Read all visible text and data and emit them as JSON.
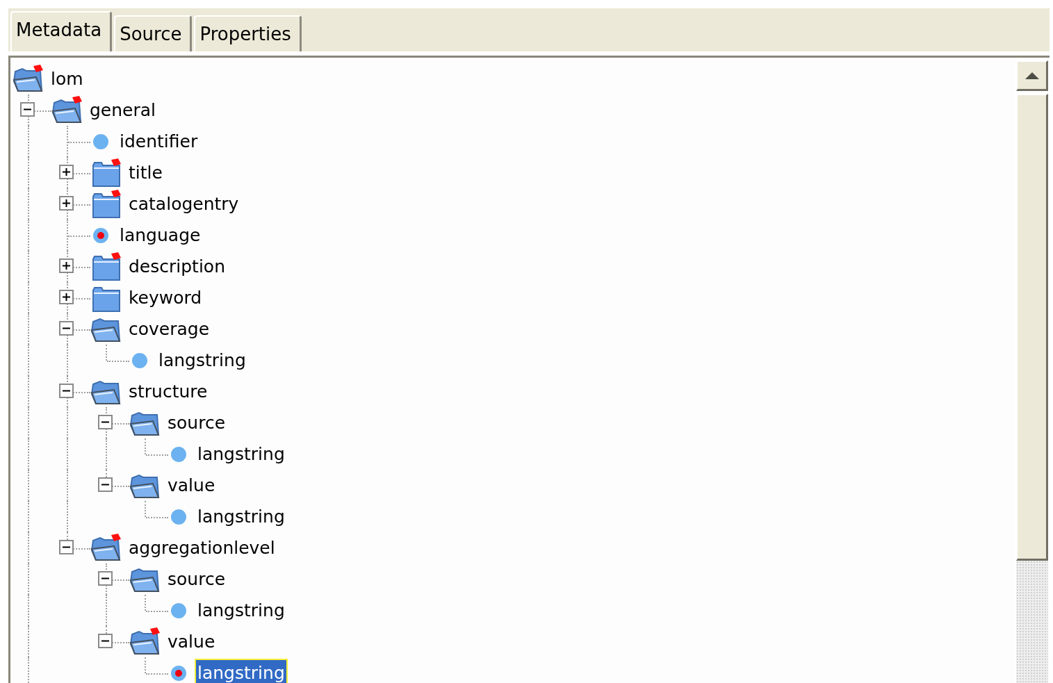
{
  "tabs": [
    {
      "label": "Metadata",
      "selected": true
    },
    {
      "label": "Source",
      "selected": false
    },
    {
      "label": "Properties",
      "selected": false
    }
  ],
  "tree": [
    {
      "kind": "folder",
      "label": "lom",
      "expanded": true,
      "flagged": true,
      "selected": false,
      "children": [
        {
          "kind": "folder",
          "label": "general",
          "expanded": true,
          "flagged": true,
          "selected": false,
          "children": [
            {
              "kind": "leaf",
              "label": "identifier",
              "flagged": false,
              "selected": false
            },
            {
              "kind": "folder",
              "label": "title",
              "expanded": false,
              "flagged": true,
              "selected": false
            },
            {
              "kind": "folder",
              "label": "catalogentry",
              "expanded": false,
              "flagged": true,
              "selected": false
            },
            {
              "kind": "leaf",
              "label": "language",
              "flagged": true,
              "selected": false
            },
            {
              "kind": "folder",
              "label": "description",
              "expanded": false,
              "flagged": true,
              "selected": false
            },
            {
              "kind": "folder",
              "label": "keyword",
              "expanded": false,
              "flagged": false,
              "selected": false
            },
            {
              "kind": "folder",
              "label": "coverage",
              "expanded": true,
              "flagged": false,
              "selected": false,
              "children": [
                {
                  "kind": "leaf",
                  "label": "langstring",
                  "flagged": false,
                  "selected": false
                }
              ]
            },
            {
              "kind": "folder",
              "label": "structure",
              "expanded": true,
              "flagged": false,
              "selected": false,
              "children": [
                {
                  "kind": "folder",
                  "label": "source",
                  "expanded": true,
                  "flagged": false,
                  "selected": false,
                  "children": [
                    {
                      "kind": "leaf",
                      "label": "langstring",
                      "flagged": false,
                      "selected": false
                    }
                  ]
                },
                {
                  "kind": "folder",
                  "label": "value",
                  "expanded": true,
                  "flagged": false,
                  "selected": false,
                  "children": [
                    {
                      "kind": "leaf",
                      "label": "langstring",
                      "flagged": false,
                      "selected": false
                    }
                  ]
                }
              ]
            },
            {
              "kind": "folder",
              "label": "aggregationlevel",
              "expanded": true,
              "flagged": true,
              "selected": false,
              "children": [
                {
                  "kind": "folder",
                  "label": "source",
                  "expanded": true,
                  "flagged": false,
                  "selected": false,
                  "children": [
                    {
                      "kind": "leaf",
                      "label": "langstring",
                      "flagged": false,
                      "selected": false
                    }
                  ]
                },
                {
                  "kind": "folder",
                  "label": "value",
                  "expanded": true,
                  "flagged": true,
                  "selected": false,
                  "children": [
                    {
                      "kind": "leaf",
                      "label": "langstring",
                      "flagged": true,
                      "selected": true
                    }
                  ]
                }
              ]
            }
          ]
        }
      ]
    }
  ]
}
